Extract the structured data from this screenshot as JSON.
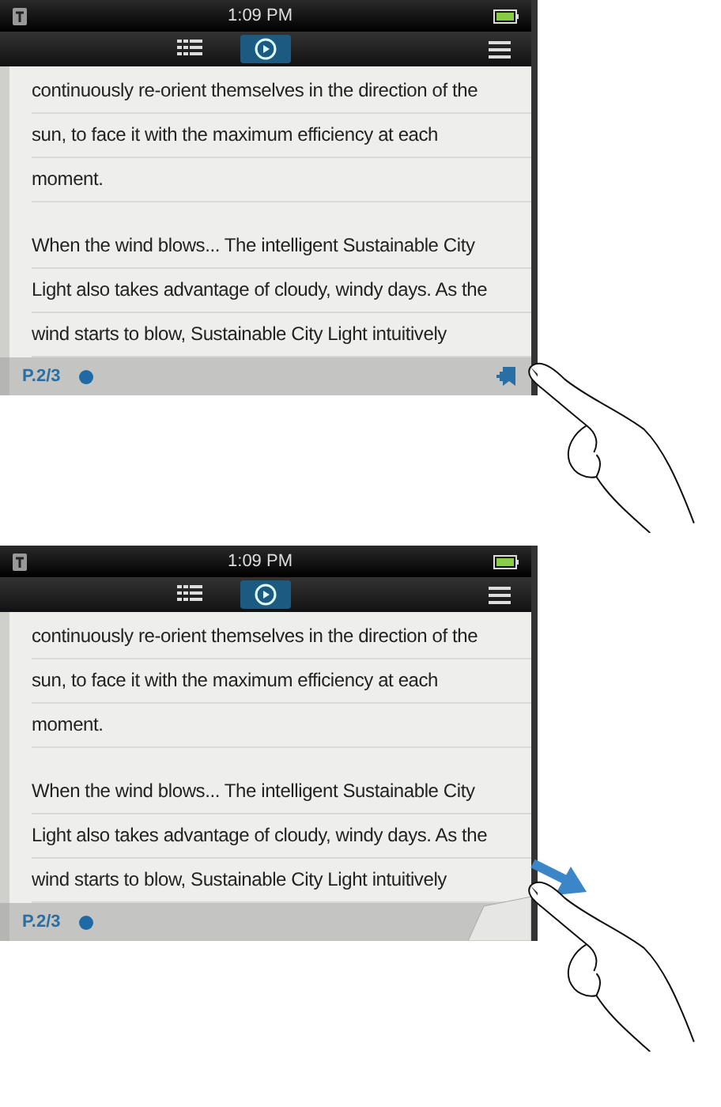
{
  "steps": [
    {
      "status_time": "1:09 PM",
      "nav": [
        {
          "kind": "list",
          "selected": false
        },
        {
          "kind": "play",
          "selected": true
        },
        {
          "kind": "menu",
          "selected": false
        }
      ],
      "paragraphs": [
        [
          "continuously re-orient themselves in the direction of the",
          "sun, to face it with the maximum efficiency at each",
          "moment."
        ],
        [
          "When the wind blows... The intelligent Sustainable City",
          "Light also takes advantage of cloudy, windy days. As the",
          "wind starts to blow, Sustainable City Light intuitively"
        ]
      ],
      "page": "P.2/3",
      "kind": "tap"
    },
    {
      "status_time": "1:09 PM",
      "nav": [
        {
          "kind": "list",
          "selected": false
        },
        {
          "kind": "play",
          "selected": true
        },
        {
          "kind": "menu",
          "selected": false
        }
      ],
      "paragraphs": [
        [
          "continuously re-orient themselves in the direction of the",
          "sun, to face it with the maximum efficiency at each",
          "moment."
        ],
        [
          "When the wind blows... The intelligent Sustainable City",
          "Light also takes advantage of cloudy, windy days. As the",
          "wind starts to blow, Sustainable City Light intuitively"
        ]
      ],
      "page": "P.2/3",
      "kind": "drag"
    }
  ]
}
